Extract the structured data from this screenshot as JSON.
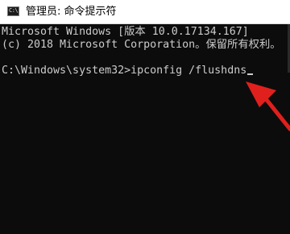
{
  "window": {
    "title": "管理员: 命令提示符",
    "icon": "cmd-icon",
    "icon_glyph": "C:\\"
  },
  "console": {
    "line1": "Microsoft Windows [版本 10.0.17134.167]",
    "line2": "(c) 2018 Microsoft Corporation。保留所有权利。",
    "prompt": "C:\\Windows\\system32>",
    "command": "ipconfig /flushdns"
  },
  "annotation": {
    "arrow_color": "#e0201c",
    "icon": "red-arrow-icon"
  },
  "colors": {
    "console_bg": "#0c0c0c",
    "console_text": "#cccccc",
    "titlebar_bg": "#ffffff"
  }
}
